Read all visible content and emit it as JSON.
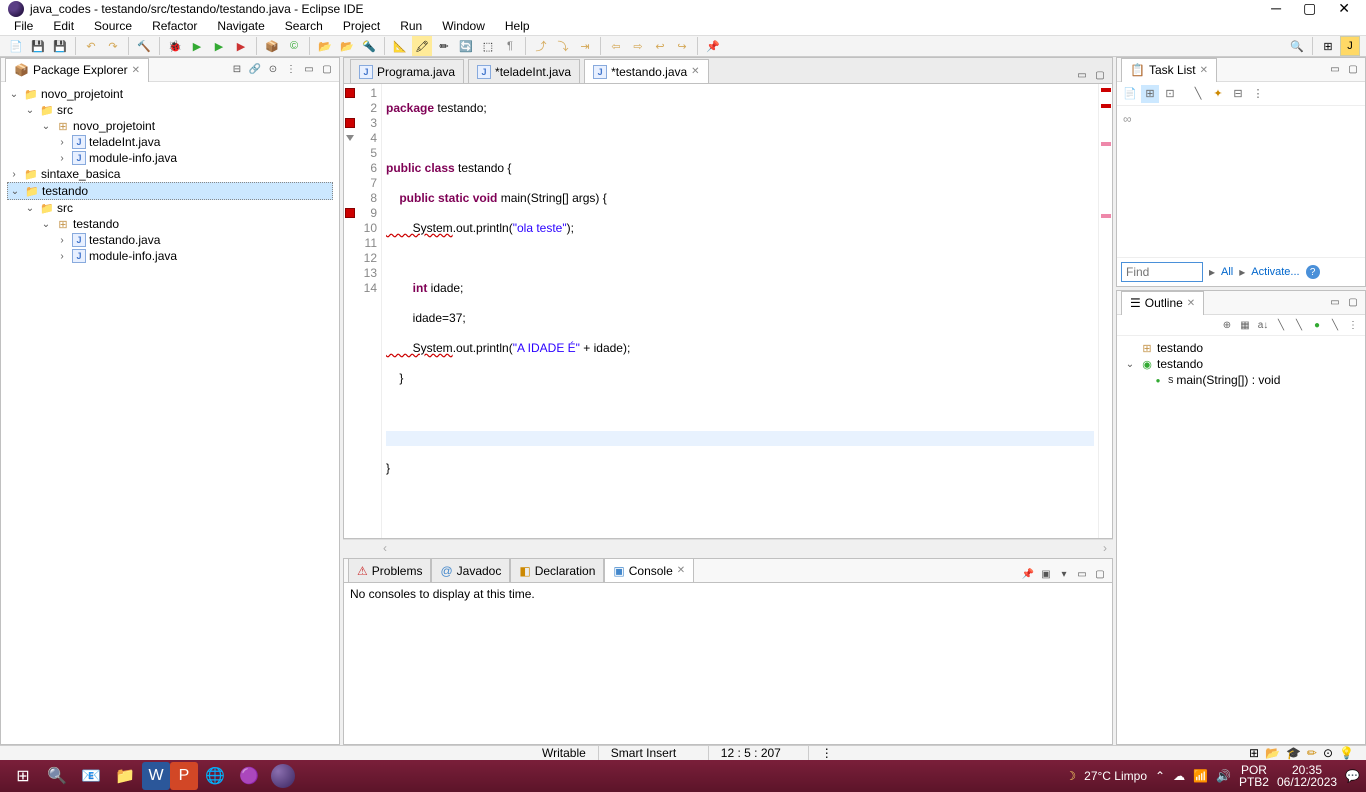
{
  "titlebar": {
    "title": "java_codes - testando/src/testando/testando.java - Eclipse IDE"
  },
  "menu": [
    "File",
    "Edit",
    "Source",
    "Refactor",
    "Navigate",
    "Search",
    "Project",
    "Run",
    "Window",
    "Help"
  ],
  "package_explorer": {
    "title": "Package Explorer",
    "tree": {
      "p0": "novo_projetoint",
      "p0_src": "src",
      "p0_pkg": "novo_projetoint",
      "p0_f1": "teladeInt.java",
      "p0_f2": "module-info.java",
      "p1": "sintaxe_basica",
      "p2": "testando",
      "p2_src": "src",
      "p2_pkg": "testando",
      "p2_f1": "testando.java",
      "p2_f2": "module-info.java"
    }
  },
  "editor_tabs": [
    {
      "label": "Programa.java",
      "dirty": false
    },
    {
      "label": "*teladeInt.java",
      "dirty": true
    },
    {
      "label": "*testando.java",
      "dirty": true,
      "active": true
    }
  ],
  "code": {
    "l1a": "package",
    "l1b": " testando;",
    "l3a": "public",
    "l3b": " class",
    "l3c": " testando {",
    "l4a": "    public",
    "l4b": " static",
    "l4c": " void",
    "l4d": " main(String[] args) {",
    "l5a": "        System",
    "l5b": ".out.println(",
    "l5c": "\"ola teste\"",
    "l5d": ");",
    "l7a": "        int",
    "l7b": " idade;",
    "l8": "        idade=37;",
    "l9a": "        System",
    "l9b": ".out.println(",
    "l9c": "\"A IDADE É\"",
    "l9d": " + idade);",
    "l10": "    }",
    "l13": "}"
  },
  "line_numbers": [
    "1",
    "2",
    "3",
    "4",
    "5",
    "6",
    "7",
    "8",
    "9",
    "10",
    "11",
    "12",
    "13",
    "14"
  ],
  "bottom_tabs": {
    "problems": "Problems",
    "javadoc": "Javadoc",
    "declaration": "Declaration",
    "console": "Console"
  },
  "console_msg": "No consoles to display at this time.",
  "tasklist": {
    "title": "Task List",
    "find_placeholder": "Find",
    "all": "All",
    "activate": "Activate..."
  },
  "outline": {
    "title": "Outline",
    "pkg": "testando",
    "cls": "testando",
    "method": "main(String[]) : void"
  },
  "status": {
    "writable": "Writable",
    "insert": "Smart Insert",
    "pos": "12 : 5 : 207"
  },
  "taskbar": {
    "weather": "27°C  Limpo",
    "lang1": "POR",
    "lang2": "PTB2",
    "time": "20:35",
    "date": "06/12/2023"
  }
}
